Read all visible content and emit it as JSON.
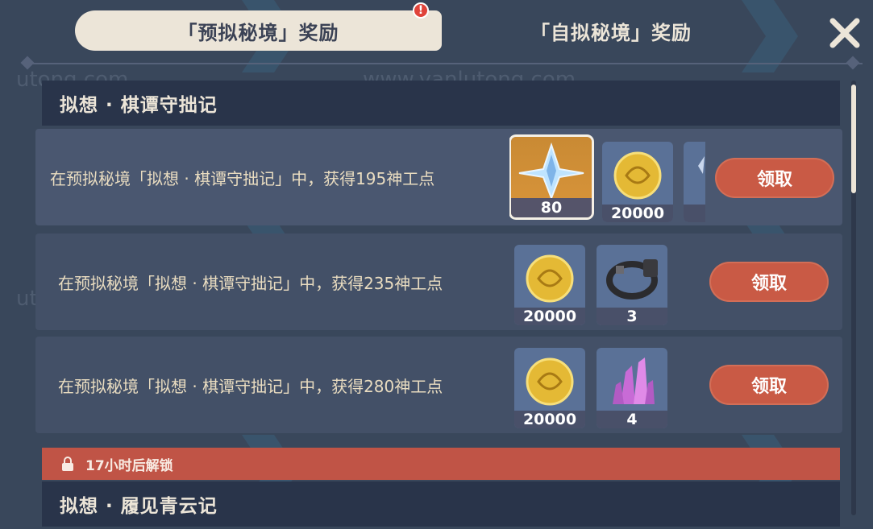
{
  "tabs": {
    "active_label": "「预拟秘境」奖励",
    "inactive_label": "「自拟秘境」奖励",
    "notice_badge": "!"
  },
  "watermark": {
    "url": "www.yanlutong.com",
    "url_partial": "utong.com"
  },
  "section1": {
    "title": "拟想 · 棋谭守拙记"
  },
  "tasks": [
    {
      "description": "在预拟秘境「拟想 · 棋谭守拙记」中，获得195神工点",
      "rewards": [
        {
          "icon": "primogem-icon",
          "count": "80"
        },
        {
          "icon": "mora-coin-icon",
          "count": "20000"
        },
        {
          "icon": "partial-item-icon",
          "count": ""
        }
      ],
      "claim_label": "领取"
    },
    {
      "description": "在预拟秘境「拟想 · 棋谭守拙记」中，获得235神工点",
      "rewards": [
        {
          "icon": "mora-coin-icon",
          "count": "20000"
        },
        {
          "icon": "iron-collar-icon",
          "count": "3"
        }
      ],
      "claim_label": "领取"
    },
    {
      "description": "在预拟秘境「拟想 · 棋谭守拙记」中，获得280神工点",
      "rewards": [
        {
          "icon": "mora-coin-icon",
          "count": "20000"
        },
        {
          "icon": "crystal-chunk-icon",
          "count": "4"
        }
      ],
      "claim_label": "领取"
    }
  ],
  "lock": {
    "text": "17小时后解锁"
  },
  "section2": {
    "title": "拟想 · 履见青云记"
  },
  "colors": {
    "background": "#39475b",
    "claim_button": "#c95a45",
    "lock_bar": "#c05446",
    "tab_active_bg": "#ece5d8"
  }
}
